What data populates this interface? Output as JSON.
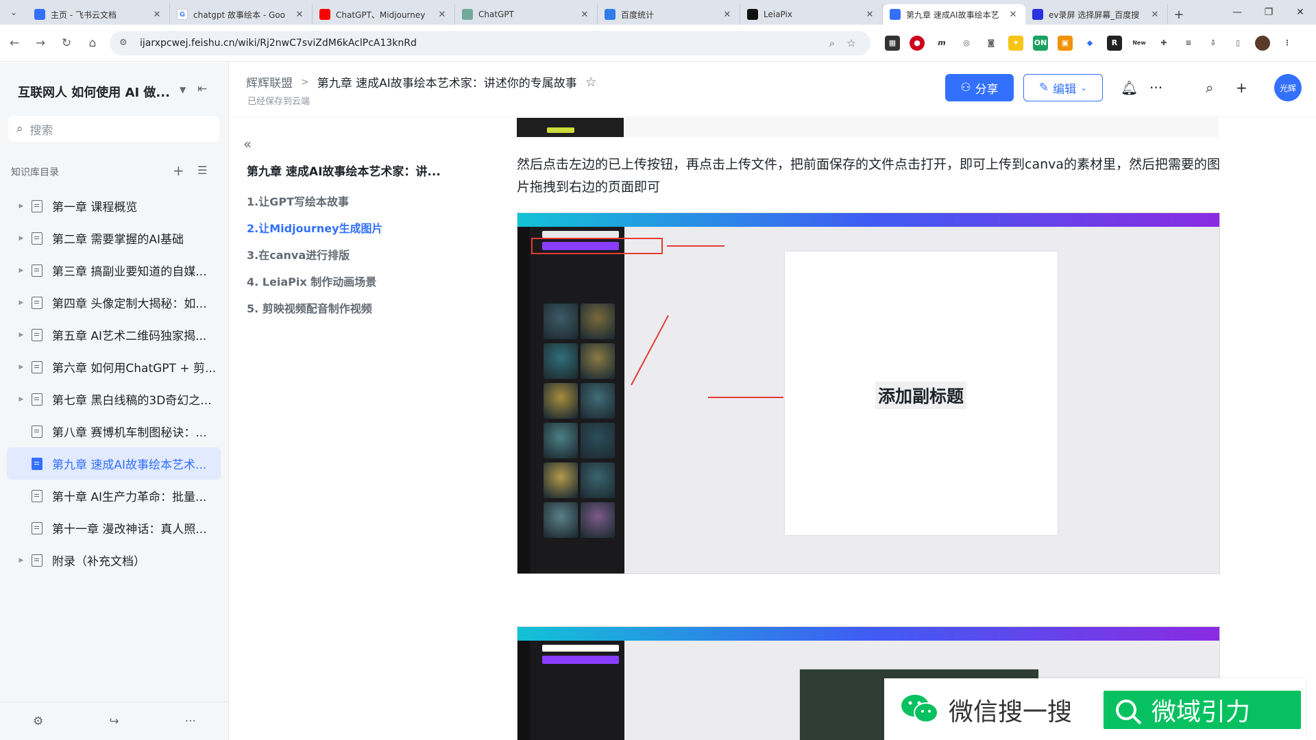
{
  "browser": {
    "tabs": [
      {
        "title": "主页 - 飞书云文档",
        "icon_color": "#3370ff",
        "icon": "feishu-icon"
      },
      {
        "title": "chatgpt 故事绘本 - Goo",
        "icon_color": "#ffffff",
        "icon": "google-icon"
      },
      {
        "title": "ChatGPT、Midjourney",
        "icon_color": "#ff0000",
        "icon": "youtube-icon"
      },
      {
        "title": "ChatGPT",
        "icon_color": "#74aa9c",
        "icon": "chatgpt-icon"
      },
      {
        "title": "百度统计",
        "icon_color": "#2f7bea",
        "icon": "baidu-tongji-icon"
      },
      {
        "title": "LeiaPix",
        "icon_color": "#111111",
        "icon": "leiapix-icon"
      },
      {
        "title": "第九章 速成AI故事绘本艺",
        "icon_color": "#3370ff",
        "icon": "feishu-doc-icon",
        "active": true
      },
      {
        "title": "ev录屏 选择屏幕_百度搜",
        "icon_color": "#2932e1",
        "icon": "baidu-icon"
      }
    ],
    "url": "ijarxpcwej.feishu.cn/wiki/Rj2nwC7sviZdM6kAclPcA13knRd"
  },
  "sidebar": {
    "space_title": "互联网人 如何使用 AI 做...",
    "search_placeholder": "搜索",
    "kb_header": "知识库目录",
    "items": [
      {
        "label": "第一章 课程概览",
        "expandable": true
      },
      {
        "label": "第二章 需要掌握的AI基础",
        "expandable": true
      },
      {
        "label": "第三章 搞副业要知道的自媒...",
        "expandable": true
      },
      {
        "label": "第四章 头像定制大揭秘：如...",
        "expandable": true
      },
      {
        "label": "第五章 AI艺术二维码独家揭...",
        "expandable": true
      },
      {
        "label": "第六章 如何用ChatGPT + 剪...",
        "expandable": true
      },
      {
        "label": "第七章 黑白线稿的3D奇幻之...",
        "expandable": true
      },
      {
        "label": "第八章 赛博机车制图秘诀：...",
        "expandable": false
      },
      {
        "label": "第九章 速成AI故事绘本艺术...",
        "expandable": false,
        "active": true
      },
      {
        "label": "第十章 AI生产力革命：批量...",
        "expandable": false
      },
      {
        "label": "第十一章 漫改神话：真人照...",
        "expandable": false
      },
      {
        "label": "附录（补充文档）",
        "expandable": true
      }
    ]
  },
  "doc_header": {
    "breadcrumb_root": "辉辉联盟",
    "breadcrumb_current": "第九章 速成AI故事绘本艺术家：讲述你的专属故事",
    "saved_status": "已经保存到云端",
    "share_label": "分享",
    "edit_label": "编辑",
    "avatar_text": "光辉"
  },
  "toc": {
    "title": "第九章 速成AI故事绘本艺术家：讲...",
    "items": [
      {
        "label": "1.让GPT写绘本故事"
      },
      {
        "label": "2.让Midjourney生成图片",
        "active": true
      },
      {
        "label": "3.在canva进行排版"
      },
      {
        "label": "4. LeiaPix 制作动画场景"
      },
      {
        "label": "5. 剪映视频配音制作视频"
      }
    ]
  },
  "content": {
    "paragraph": "然后点击左边的已上传按钮，再点击上传文件，把前面保存的文件点击打开，即可上传到canva的素材里，然后把需要的图片拖拽到右边的页面即可",
    "canvas_subtitle": "添加副标题"
  },
  "watermark": {
    "wx_text": "微信搜一搜",
    "wx_green_text": "微域引力"
  },
  "colors": {
    "accent": "#3370ff",
    "annotation_red": "#e53935",
    "wechat_green": "#07c160",
    "canva_purple": "#8b3dff"
  }
}
